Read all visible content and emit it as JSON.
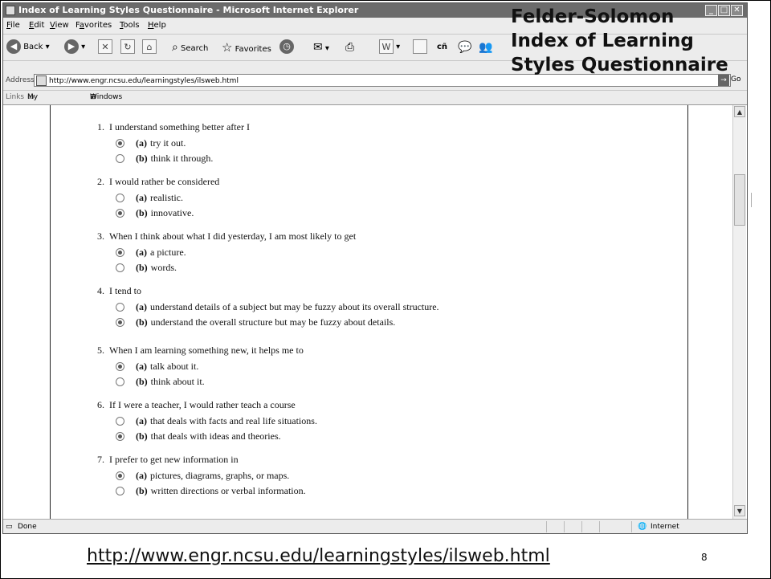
{
  "window": {
    "title": "Index of Learning Styles Questionnaire - Microsoft Internet Explorer",
    "controls": [
      "minimize",
      "maximize",
      "close"
    ]
  },
  "menu": [
    {
      "pre": "",
      "u": "F",
      "post": "ile"
    },
    {
      "pre": "",
      "u": "E",
      "post": "dit"
    },
    {
      "pre": "",
      "u": "V",
      "post": "iew"
    },
    {
      "pre": "F",
      "u": "a",
      "post": "vorites"
    },
    {
      "pre": "",
      "u": "T",
      "post": "ools"
    },
    {
      "pre": "",
      "u": "H",
      "post": "elp"
    }
  ],
  "toolbar": {
    "back_label": "Back",
    "search_label": "Search",
    "favorites_label": "Favorites"
  },
  "address": {
    "label": "Address",
    "url": "http://www.engr.ncsu.edu/learningstyles/ilsweb.html",
    "go_label": "Go"
  },
  "links": {
    "label": "Links",
    "items": [
      "My Documents",
      "Windows Marketplace"
    ]
  },
  "questions": [
    {
      "num": "1.",
      "text": "I understand something better after I",
      "options": [
        {
          "letter": "(a)",
          "text": "try it out.",
          "selected": true
        },
        {
          "letter": "(b)",
          "text": "think it through.",
          "selected": false
        }
      ]
    },
    {
      "num": "2.",
      "text": "I would rather be considered",
      "options": [
        {
          "letter": "(a)",
          "text": "realistic.",
          "selected": false
        },
        {
          "letter": "(b)",
          "text": "innovative.",
          "selected": true
        }
      ]
    },
    {
      "num": "3.",
      "text": "When I think about what I did yesterday, I am most likely to get",
      "options": [
        {
          "letter": "(a)",
          "text": "a picture.",
          "selected": true
        },
        {
          "letter": "(b)",
          "text": "words.",
          "selected": false
        }
      ]
    },
    {
      "num": "4.",
      "text": "I tend to",
      "options": [
        {
          "letter": "(a)",
          "text": "understand details of a subject but may be fuzzy about its overall structure.",
          "selected": false
        },
        {
          "letter": "(b)",
          "text": "understand the overall structure but may be fuzzy about details.",
          "selected": true
        }
      ]
    },
    {
      "num": "5.",
      "text": "When I am learning something new, it helps me to",
      "options": [
        {
          "letter": "(a)",
          "text": "talk about it.",
          "selected": true
        },
        {
          "letter": "(b)",
          "text": "think about it.",
          "selected": false
        }
      ]
    },
    {
      "num": "6.",
      "text": "If I were a teacher, I would rather teach a course",
      "options": [
        {
          "letter": "(a)",
          "text": "that deals with facts and real life situations.",
          "selected": false
        },
        {
          "letter": "(b)",
          "text": "that deals with ideas and theories.",
          "selected": true
        }
      ]
    },
    {
      "num": "7.",
      "text": "I prefer to get new information in",
      "options": [
        {
          "letter": "(a)",
          "text": "pictures, diagrams, graphs, or maps.",
          "selected": true
        },
        {
          "letter": "(b)",
          "text": "written directions or verbal information.",
          "selected": false
        }
      ]
    }
  ],
  "status": {
    "left": "Done",
    "zone": "Internet"
  },
  "slide": {
    "title_lines": [
      "Felder-Solomon",
      "Index of Learning",
      "Styles Questionnaire"
    ],
    "footer_url": "http://www.engr.ncsu.edu/learningstyles/ilsweb.html",
    "page_number": "8"
  }
}
